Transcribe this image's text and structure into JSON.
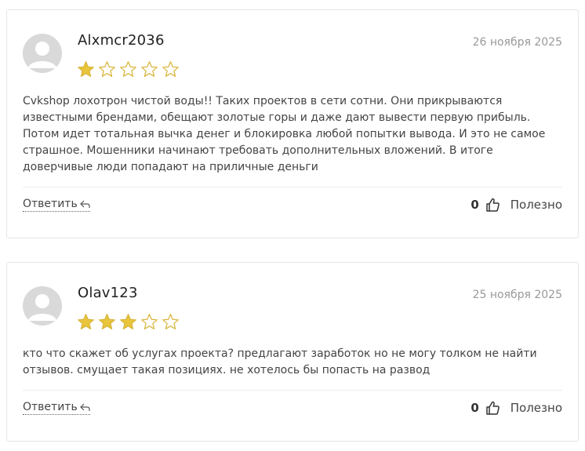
{
  "colors": {
    "star_filled": "#E9C53B",
    "star_empty_stroke": "#D8B53A",
    "avatar_bg": "#D9D9D9",
    "card_border": "#E6E6E6",
    "date_text": "#999999"
  },
  "reviews": [
    {
      "author": "Alxmcr2036",
      "date": "26 ноября 2025",
      "rating": 1,
      "max_rating": 5,
      "text": "Cvkshop лохотрон чистой воды!! Таких проектов в сети сотни. Они прикрываются известными брендами, обещают золотые горы и даже дают вывести первую прибыль. Потом идет тотальная вычка денег и блокировка любой попытки вывода. И это не самое страшное. Мошенники начинают требовать дополнительных вложений. В итоге доверчивые люди попадают на приличные деньги",
      "reply_label": "Ответить",
      "helpful_count": "0",
      "helpful_label": "Полезно",
      "avatar_icon": "user-silhouette-icon"
    },
    {
      "author": "Olav123",
      "date": "25 ноября 2025",
      "rating": 3,
      "max_rating": 5,
      "text": "кто что скажет об услугах проекта? предлагают заработок но не могу толком не найти отзывов. смущает такая позициях. не хотелось бы попасть на развод",
      "reply_label": "Ответить",
      "helpful_count": "0",
      "helpful_label": "Полезно",
      "avatar_icon": "user-silhouette-icon"
    }
  ]
}
